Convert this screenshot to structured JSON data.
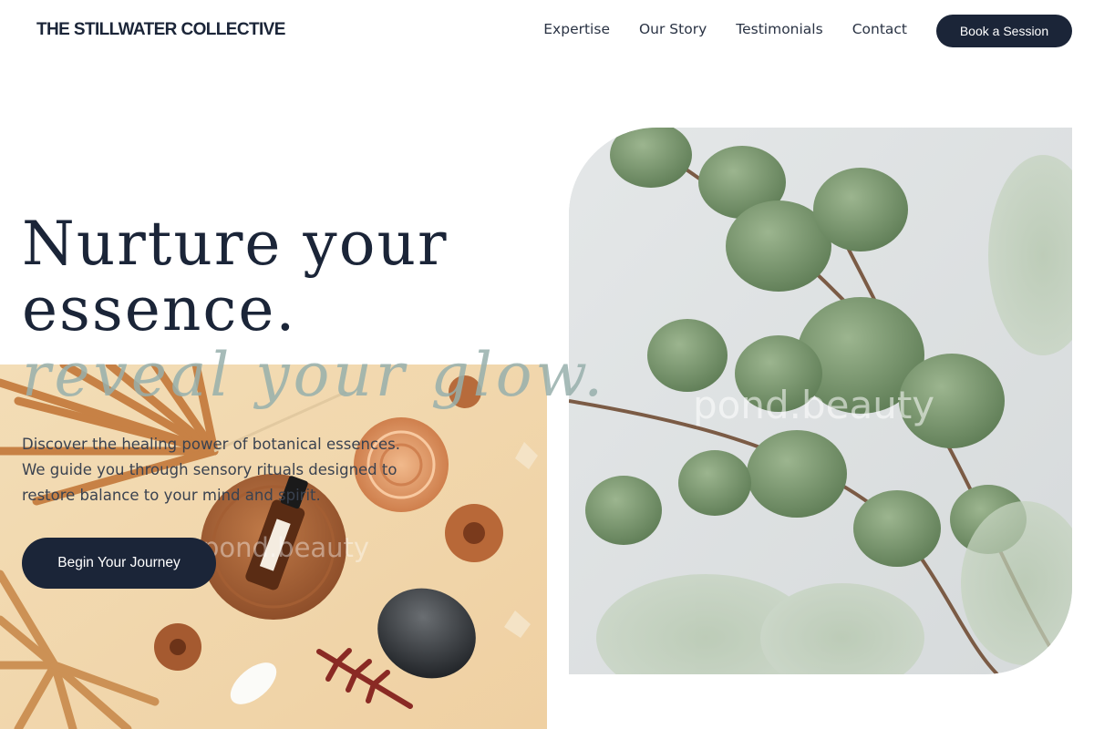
{
  "brand": {
    "name": "THE STILLWATER COLLECTIVE"
  },
  "nav": {
    "items": [
      {
        "label": "Expertise"
      },
      {
        "label": "Our Story"
      },
      {
        "label": "Testimonials"
      },
      {
        "label": "Contact"
      }
    ],
    "cta_label": "Book a Session"
  },
  "hero": {
    "title_line1": "Nurture your",
    "title_line2": "essence.",
    "accent_line": "reveal your glow.",
    "description_lines": [
      "Discover the healing power of botanical essences.",
      "We guide you through sensory rituals designed to",
      "restore balance to your mind and spirit."
    ],
    "cta_label": "Begin Your Journey"
  },
  "images": {
    "left": {
      "watermark": "pond.beauty"
    },
    "right": {
      "watermark": "pond.beauty"
    }
  },
  "colors": {
    "primary": "#1b2538",
    "accent": "#96afac",
    "background": "#ffffff",
    "sand": "#f0d7ae",
    "eucalyptus": "#7f9c74"
  }
}
